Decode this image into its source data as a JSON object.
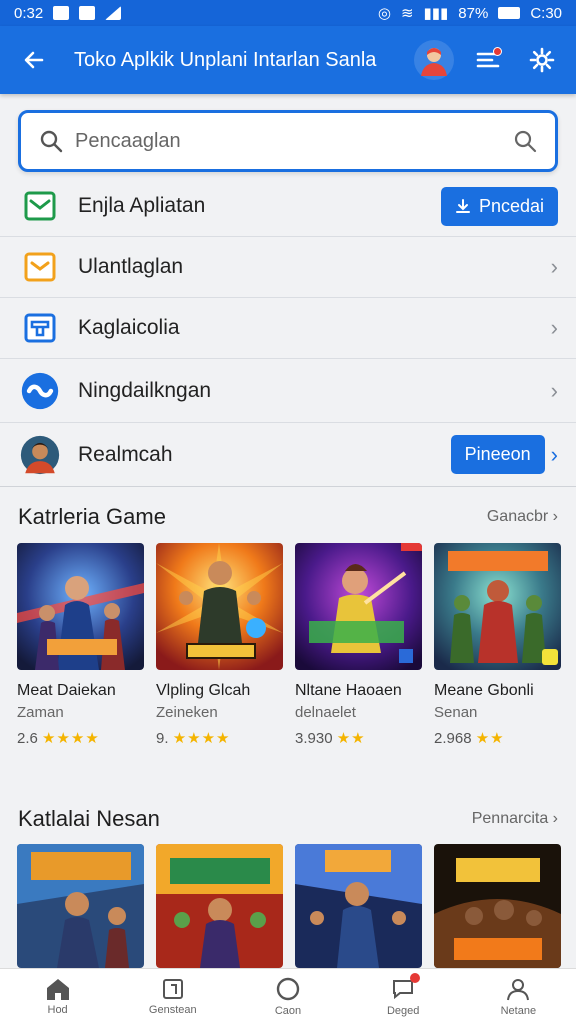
{
  "status_bar": {
    "time_left": "0:32",
    "battery_pct": "87%",
    "time_right": "C:30"
  },
  "app_bar": {
    "title": "Toko Aplkik Unplani Intarlan Sanla"
  },
  "search": {
    "placeholder": "Pencaaglan"
  },
  "menu": [
    {
      "label": "Enjla Apliatan",
      "icon": "green-check-icon",
      "action": "Pncedai"
    },
    {
      "label": "Ulantlaglan",
      "icon": "orange-check-icon"
    },
    {
      "label": "Kaglaicolia",
      "icon": "blue-box-icon"
    },
    {
      "label": "Ningdailkngan",
      "icon": "circle-logo-icon"
    },
    {
      "label": "Realmcah",
      "icon": "portrait-avatar",
      "action": "Pineeon"
    }
  ],
  "section1": {
    "title": "Katrleria Game",
    "more": "Ganacbr",
    "cards": [
      {
        "title": "Meat Daiekan",
        "sub": "Zaman",
        "rating": "2.6",
        "stars": "★★★★"
      },
      {
        "title": "Vlpling Glcah",
        "sub": "Zeineken",
        "rating": "9.",
        "stars": "★★★★"
      },
      {
        "title": "Nltane Haoaen",
        "sub": "delnaelet",
        "rating": "3.930",
        "stars": "★★"
      },
      {
        "title": "Meane Gbonli",
        "sub": "Senan",
        "rating": "2.968",
        "stars": "★★"
      }
    ]
  },
  "section2": {
    "title": "Katlalai Nesan",
    "more": "Pennarcita"
  },
  "bottom_nav": [
    {
      "label": "Hod",
      "icon": "home-icon"
    },
    {
      "label": "Genstean",
      "icon": "bookmark-icon"
    },
    {
      "label": "Caon",
      "icon": "circle-icon"
    },
    {
      "label": "Deged",
      "icon": "chat-icon"
    },
    {
      "label": "Netane",
      "icon": "person-icon"
    }
  ],
  "colors": {
    "primary": "#1a6fe0",
    "star": "#f4b400",
    "badge": "#e53935"
  }
}
